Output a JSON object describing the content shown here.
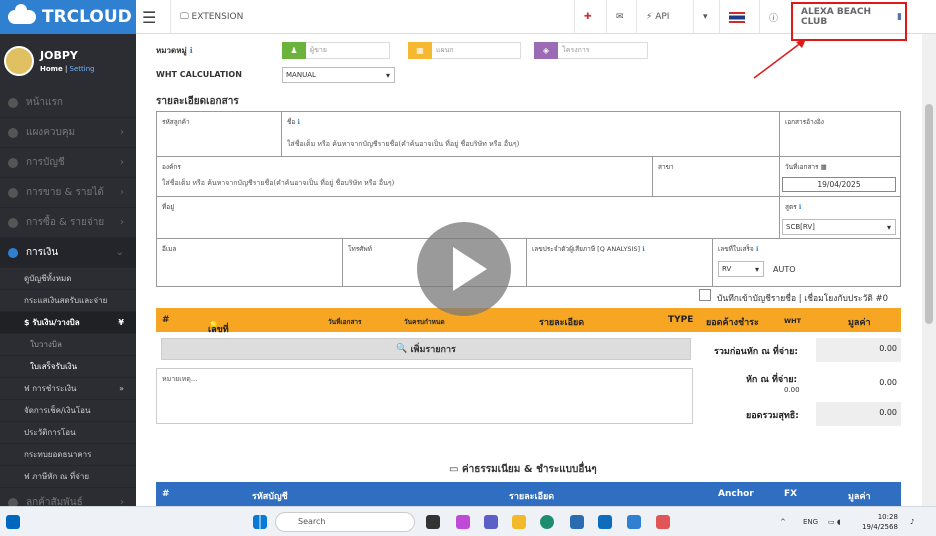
{
  "app": {
    "brand": "TRCLOUD"
  },
  "topnav": {
    "extension": "EXTENSION",
    "api": "API",
    "company": "ALEXA BEACH CLUB"
  },
  "user": {
    "name": "JOBPY",
    "home": "Home",
    "setting": "Setting"
  },
  "menu": [
    {
      "label": "หน้าแรก"
    },
    {
      "label": "แผงควบคุม"
    },
    {
      "label": "การบัญชี"
    },
    {
      "label": "การขาย & รายได้"
    },
    {
      "label": "การซื้อ & รายจ่าย"
    },
    {
      "label": "การเงิน"
    }
  ],
  "submenu": {
    "items": [
      "ดูบัญชีทั้งหมด",
      "กระแสเงินสดรับและจ่าย"
    ],
    "section": "$ รับเงิน/วางบิล",
    "sub": [
      "ใบวางบิล",
      "ใบเสร็จรับเงิน"
    ],
    "more": [
      "ฟ การชำระเงิน",
      "จัดการเช็ค/เงินโอน",
      "ประวัติการโอน",
      "กระทบยอดธนาคาร",
      "ฟ ภาษีหัก ณ ที่จ่าย"
    ],
    "bottom": "ลูกค้าสัมพันธ์"
  },
  "form": {
    "category_label": "หมวดหมู่",
    "btn_person": "ผู้ขาย",
    "btn_dept": "แผนก",
    "btn_project": "โครงการ",
    "wht_label": "WHT CALCULATION",
    "wht_value": "MANUAL",
    "section_title": "รายละเอียดเอกสาร",
    "client_code": "รหัสลูกค้า",
    "name": "ชื่อ",
    "name_hint": "ใส่ชื่อเต็ม หรือ ค้นหาจากบัญชีรายชื่อ(คำค้นอาจเป็น ที่อยู่ ชื่อบริษัท หรือ อื่นๆ)",
    "reference": "เอกสารอ้างอิง",
    "org": "องค์กร",
    "org_hint": "ใส่ชื่อเต็ม หรือ ค้นหาจากบัญชีรายชื่อ(คำค้นอาจเป็น ที่อยู่ ชื่อบริษัท หรือ อื่นๆ)",
    "branch": "สาขา",
    "doc_date": "วันที่เอกสาร",
    "doc_date_value": "19/04/2025",
    "address": "ที่อยู่",
    "formula": "สูตร",
    "formula_value": "SCB[RV]",
    "email": "อีเมล",
    "phone": "โทรศัพท์",
    "tax_id": "เลขประจำตัวผู้เสียภาษี [Q ANALYSIS]",
    "receipt_no": "เลขที่ใบเสร็จ",
    "receipt_prefix": "RV",
    "receipt_auto": "AUTO",
    "ledger_check": "บันทึกเข้าบัญชีรายชื่อ | เชื่อมโยงกับประวัติ #0"
  },
  "table": {
    "cols": [
      "#",
      "เลขที่เอกสาร",
      "วันที่เอกสาร",
      "วันครบกำหนด",
      "รายละเอียด",
      "TYPE",
      "ยอดค้างชำระ",
      "WHT",
      "มูลค่า"
    ],
    "add_item": "เพิ่มรายการ",
    "note_placeholder": "หมายเหตุ...",
    "total_before_wht": "รวมก่อนหัก ณ ที่จ่าย:",
    "total_before_wht_value": "0.00",
    "wht": "หัก ณ ที่จ่าย:",
    "wht_small": "0.00",
    "wht_value": "0.00",
    "net": "ยอดรวมสุทธิ:",
    "net_value": "0.00"
  },
  "fees": {
    "title": "ค่าธรรมเนียม & ชำระแบบอื่นๆ",
    "cols": [
      "#",
      "รหัสบัญชี",
      "รายละเอียด",
      "Anchor",
      "FX",
      "มูลค่า"
    ]
  },
  "taskbar": {
    "search": "Search",
    "lang": "ENG",
    "time": "10:28",
    "date": "19/4/2568"
  }
}
